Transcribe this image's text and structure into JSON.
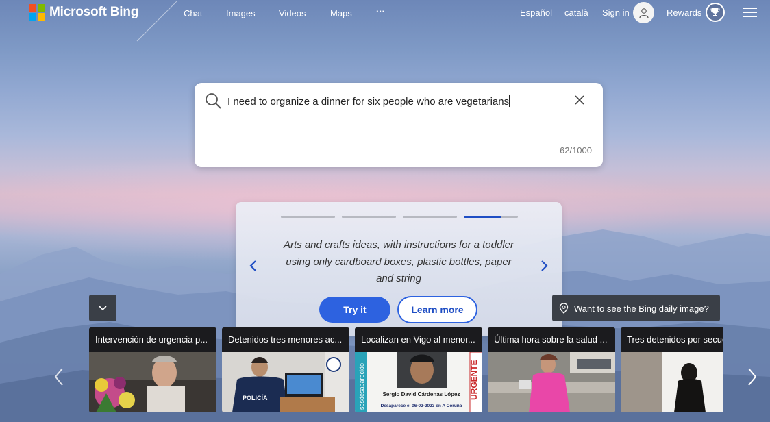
{
  "header": {
    "brand": "Microsoft Bing",
    "nav": [
      "Chat",
      "Images",
      "Videos",
      "Maps",
      "···"
    ],
    "lang1": "Español",
    "lang2": "català",
    "sign_in": "Sign in",
    "rewards": "Rewards"
  },
  "search": {
    "value": "I need to organize a dinner for six people who are vegetarians",
    "char_count": "62/1000"
  },
  "suggestion": {
    "text": "Arts and crafts ideas, with instructions for a toddler using only cardboard boxes, plastic bottles, paper and string",
    "progress": [
      1,
      1,
      1,
      0.7
    ],
    "try_label": "Try it",
    "learn_label": "Learn more"
  },
  "daily_image": {
    "text": "Want to see the Bing daily image?"
  },
  "news": [
    {
      "title": "Intervención de urgencia p..."
    },
    {
      "title": "Detenidos tres menores ac..."
    },
    {
      "title": "Localizan en Vigo al menor..."
    },
    {
      "title": "Última hora sobre la salud ..."
    },
    {
      "title": "Tres detenidos por secue"
    }
  ],
  "news_poster": {
    "name": "Sergio David Cárdenas López",
    "date": "Desaparece el 06-02-2023 en A Coruña",
    "urgent": "URGENTE",
    "side": "sosdesaparecido",
    "badge": "POLICÍA"
  },
  "colors": {
    "accent": "#2d62e0",
    "logo_red": "#f25022",
    "logo_green": "#7fba00",
    "logo_blue": "#00a4ef",
    "logo_yellow": "#ffb900"
  },
  "icons": [
    "search-icon",
    "close-icon",
    "user-icon",
    "trophy-icon",
    "menu-icon",
    "chevron-left-icon",
    "chevron-right-icon",
    "chevron-down-icon",
    "location-pin-icon"
  ]
}
